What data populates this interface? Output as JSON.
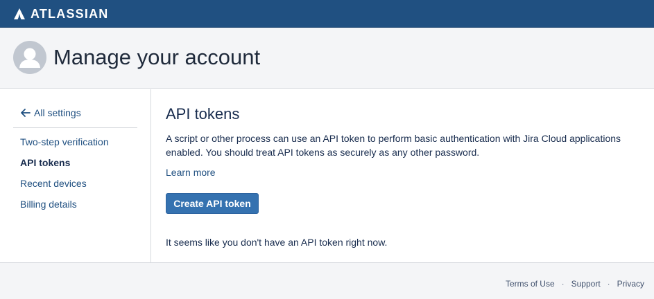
{
  "topbar": {
    "brand": "ATLASSIAN",
    "logo_icon": "atlassian-logo-icon",
    "background": "#205081"
  },
  "header": {
    "avatar_icon": "user-avatar-icon",
    "title": "Manage your account"
  },
  "sidebar": {
    "back_label": "All settings",
    "back_icon": "arrow-left-icon",
    "items": [
      {
        "label": "Two-step verification",
        "active": false
      },
      {
        "label": "API tokens",
        "active": true
      },
      {
        "label": "Recent devices",
        "active": false
      },
      {
        "label": "Billing details",
        "active": false
      }
    ]
  },
  "main": {
    "title": "API tokens",
    "description": "A script or other process can use an API token to perform basic authentication with Jira Cloud applications enabled. You should treat API tokens as securely as any other password.",
    "learn_more": "Learn more",
    "create_button": "Create API token",
    "empty_state": "It seems like you don't have an API token right now."
  },
  "footer": {
    "links": [
      "Terms of Use",
      "Support",
      "Privacy"
    ],
    "separator": "·"
  },
  "colors": {
    "link": "#205081",
    "primary_button": "#3572b0",
    "text": "#172b4d",
    "header_bg": "#f4f5f7"
  }
}
